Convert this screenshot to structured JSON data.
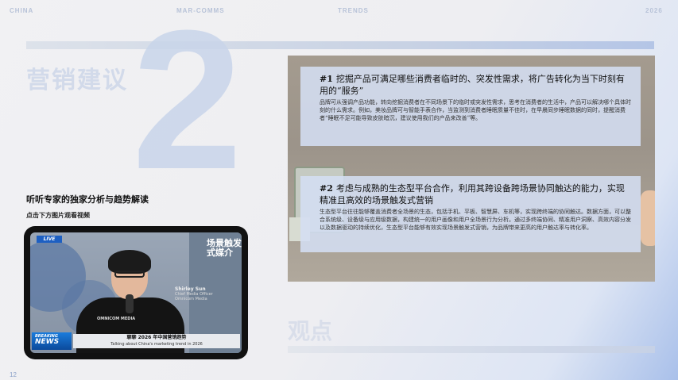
{
  "nav": {
    "left": "CHINA",
    "center_left": "MAR-COMMS",
    "center_right": "TRENDS",
    "right": "2026"
  },
  "big_number": "2",
  "section_title": "营销建议",
  "headline": "听听专家的独家分析与趋势解读",
  "subhead": "点击下方图片观看视频",
  "video": {
    "live_label": "LIVE",
    "scene_text": "场景触发式媒介",
    "brand": "OMNICOM MEDIA",
    "speaker_name": "Shirley Sun",
    "speaker_role_line1": "Chief Media Officer",
    "speaker_role_line2": "Omnicom Media",
    "news_badge_top": "BREAKING",
    "news_badge_bottom": "NEWS",
    "news_title": "聊聊 2026 年中国营销趋势",
    "news_subtitle": "Talking about China's marketing trend in 2026"
  },
  "panels": [
    {
      "number": "#1",
      "title": "挖掘产品可满足哪些消费者临时的、突发性需求，将广告转化为当下时刻有用的“服务”",
      "body": "品牌可从强调产品功能，转向挖掘消费者在不同场景下的临时或突发性需求，思考在消费者的生活中，产品可以解决哪个具体时刻的什么需求。例如，美妆品牌可与智能手表合作，当监测到消费者睡眠质量不佳时，在早晨同步睡眠数据的同时，提醒消费者“睡眠不足可能导致皮肤暗沉，建议使用我们的产品来改善”等。"
    },
    {
      "number": "#2",
      "title": "考虑与成熟的生态型平台合作，利用其跨设备跨场景协同触达的能力，实现精准且高效的场景触发式营销",
      "body": "生态型平台往往能够覆盖消费者全场景的生态，包括手机、平板、智慧屏、车机等，实现跨终端的协同触达。数据方面，可以整合系统级、设备级与应用级数据，构建统一的用户画像和用户全场景行为分析。通过多终端协同、精准用户洞察、高效内容分发以及数据驱动的持续优化，生态型平台能够有效实现场景触发式营销，为品牌带来更高的用户触达率与转化率。"
    }
  ],
  "opinion_label": "观点",
  "page_number": "12"
}
